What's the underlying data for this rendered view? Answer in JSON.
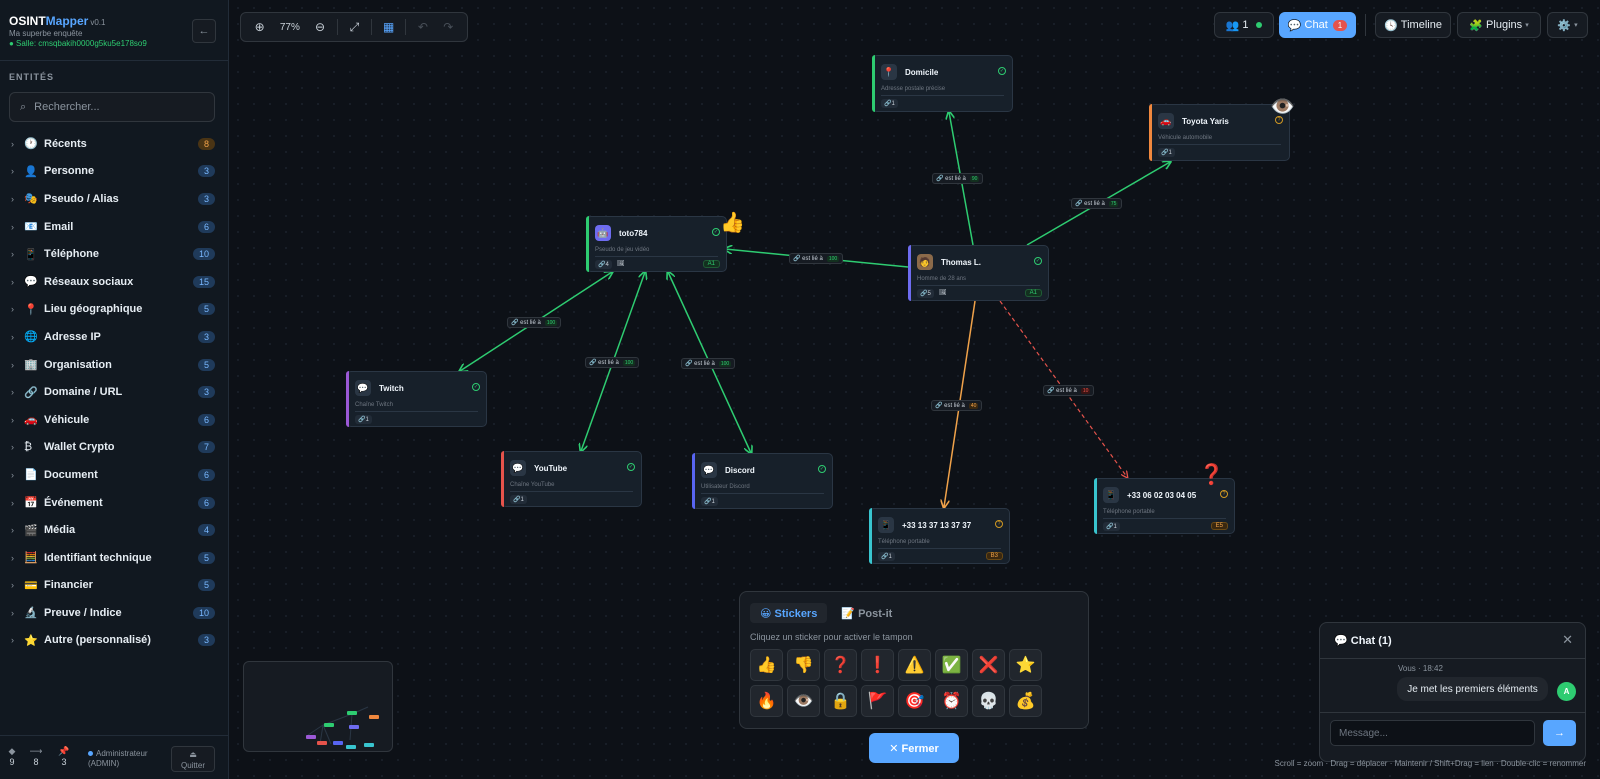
{
  "brand": {
    "name_a": "OSINT",
    "name_b": "Mapper",
    "version": "v0.1",
    "subtitle": "Ma superbe enquête",
    "room": "● Salle: cmsqbakih0000g5ku5e178so9",
    "collapse": "←"
  },
  "sidebar": {
    "section": "ENTITÉS",
    "search_placeholder": "Rechercher...",
    "categories": [
      {
        "emoji": "🕐",
        "label": "Récents",
        "count": "8"
      },
      {
        "emoji": "👤",
        "label": "Personne",
        "count": "3"
      },
      {
        "emoji": "🎭",
        "label": "Pseudo / Alias",
        "count": "3"
      },
      {
        "emoji": "📧",
        "label": "Email",
        "count": "6"
      },
      {
        "emoji": "📱",
        "label": "Téléphone",
        "count": "10"
      },
      {
        "emoji": "💬",
        "label": "Réseaux sociaux",
        "count": "15"
      },
      {
        "emoji": "📍",
        "label": "Lieu géographique",
        "count": "5"
      },
      {
        "emoji": "🌐",
        "label": "Adresse IP",
        "count": "3"
      },
      {
        "emoji": "🏢",
        "label": "Organisation",
        "count": "5"
      },
      {
        "emoji": "🔗",
        "label": "Domaine / URL",
        "count": "3"
      },
      {
        "emoji": "🚗",
        "label": "Véhicule",
        "count": "6"
      },
      {
        "emoji": "₿",
        "label": "Wallet Crypto",
        "count": "7"
      },
      {
        "emoji": "📄",
        "label": "Document",
        "count": "6"
      },
      {
        "emoji": "📅",
        "label": "Événement",
        "count": "6"
      },
      {
        "emoji": "🎬",
        "label": "Média",
        "count": "4"
      },
      {
        "emoji": "🧮",
        "label": "Identifiant technique",
        "count": "5"
      },
      {
        "emoji": "💳",
        "label": "Financier",
        "count": "5"
      },
      {
        "emoji": "🔬",
        "label": "Preuve / Indice",
        "count": "10"
      },
      {
        "emoji": "⭐",
        "label": "Autre (personnalisé)",
        "count": "3"
      }
    ],
    "footer": {
      "nodes_symbol": "◆",
      "nodes": "9",
      "links_symbol": "⟶",
      "links": "8",
      "pins_symbol": "📌",
      "pins": "3",
      "role_line1": "Administrateur",
      "role_line2": "(ADMIN)",
      "quit_icon": "⏏",
      "quit_label": "Quitter"
    }
  },
  "toolbar": {
    "zoom": "77%",
    "zoom_in": "⊕",
    "zoom_out": "⊖",
    "fit": "⤢",
    "layout": "▦",
    "undo": "↶",
    "redo": "↷"
  },
  "topbar": {
    "users_icon": "👥",
    "users_count": "1",
    "chat_icon": "💬",
    "chat_label": "Chat",
    "chat_badge": "1",
    "timeline_icon": "🕓",
    "timeline_label": "Timeline",
    "plugins_icon": "🧩",
    "plugins_label": "Plugins",
    "plugins_caret": "▾",
    "settings_icon": "⚙️",
    "settings_caret": "▾"
  },
  "nodes": {
    "domicile": {
      "icon": "📍",
      "title": "Domicile",
      "sub": "Adresse postale précise",
      "links": "🔗1",
      "check": "✓",
      "color": "#2ecc71"
    },
    "toyota": {
      "icon": "🚗",
      "title": "Toyota Yaris",
      "sub": "Véhicule automobile",
      "links": "🔗1",
      "check": "?",
      "color": "#f0883e"
    },
    "toto": {
      "icon": "🤖",
      "title": "toto784",
      "sub": "Pseudo de jeu vidéo",
      "links": "🔗4",
      "extra": "🖼",
      "rate": "A1",
      "check": "✓",
      "color": "#2ecc71"
    },
    "thomas": {
      "icon": "🧑",
      "title": "Thomas L.",
      "sub": "Homme de 28 ans",
      "links": "🔗5",
      "extra": "🖼",
      "rate": "A1",
      "check": "✓",
      "color": "#6e6cf0"
    },
    "twitch": {
      "icon": "💬",
      "title": "Twitch",
      "sub": "Chaîne Twitch",
      "links": "🔗1",
      "check": "✓",
      "color": "#9b59d6"
    },
    "youtube": {
      "icon": "💬",
      "title": "YouTube",
      "sub": "Chaîne YouTube",
      "links": "🔗1",
      "check": "✓",
      "color": "#e5534b"
    },
    "discord": {
      "icon": "💬",
      "title": "Discord",
      "sub": "Utilisateur Discord",
      "links": "🔗1",
      "check": "✓",
      "color": "#5865f2"
    },
    "phone1": {
      "icon": "📱",
      "title": "+33 13 37 13 37 37",
      "sub": "Téléphone portable",
      "links": "🔗1",
      "rate": "B3",
      "check": "?",
      "color": "#39c5cf"
    },
    "phone2": {
      "icon": "📱",
      "title": "+33 06 02 03 04 05",
      "sub": "Téléphone portable",
      "links": "🔗1",
      "rate": "E5",
      "check": "?",
      "color": "#39c5cf"
    }
  },
  "edges": {
    "label": "🔗 est lié à",
    "domicile_pct": "90",
    "toyota_pct": "75",
    "toto_pct": "100",
    "twitch_pct": "100",
    "youtube_pct": "100",
    "discord_pct": "100",
    "phone1_pct": "40",
    "phone2_pct": "10",
    "color_green": "#2ecc71",
    "color_orange": "#f0a24a",
    "color_red": "#e5534b"
  },
  "floating_stickers": {
    "thumbs": "👍",
    "eye": "👁️",
    "question": "❓"
  },
  "sticker_panel": {
    "tab_stickers": "😀 Stickers",
    "tab_postit": "📝 Post-it",
    "hint": "Cliquez un sticker pour activer le tampon",
    "stickers": [
      "👍",
      "👎",
      "❓",
      "❗",
      "⚠️",
      "✅",
      "❌",
      "⭐",
      "🔥",
      "👁️",
      "🔒",
      "🚩",
      "🎯",
      "⏰",
      "💀",
      "💰"
    ],
    "close": "✕ Fermer"
  },
  "chat": {
    "title": "💬 Chat (1)",
    "close": "✕",
    "meta": "Vous · 18:42",
    "message": "Je met les premiers éléments",
    "avatar": "A",
    "placeholder": "Message...",
    "send": "→"
  },
  "help": "Scroll = zoom · Drag = déplacer · Maintenir / Shift+Drag = lien · Double-clic = renommer"
}
